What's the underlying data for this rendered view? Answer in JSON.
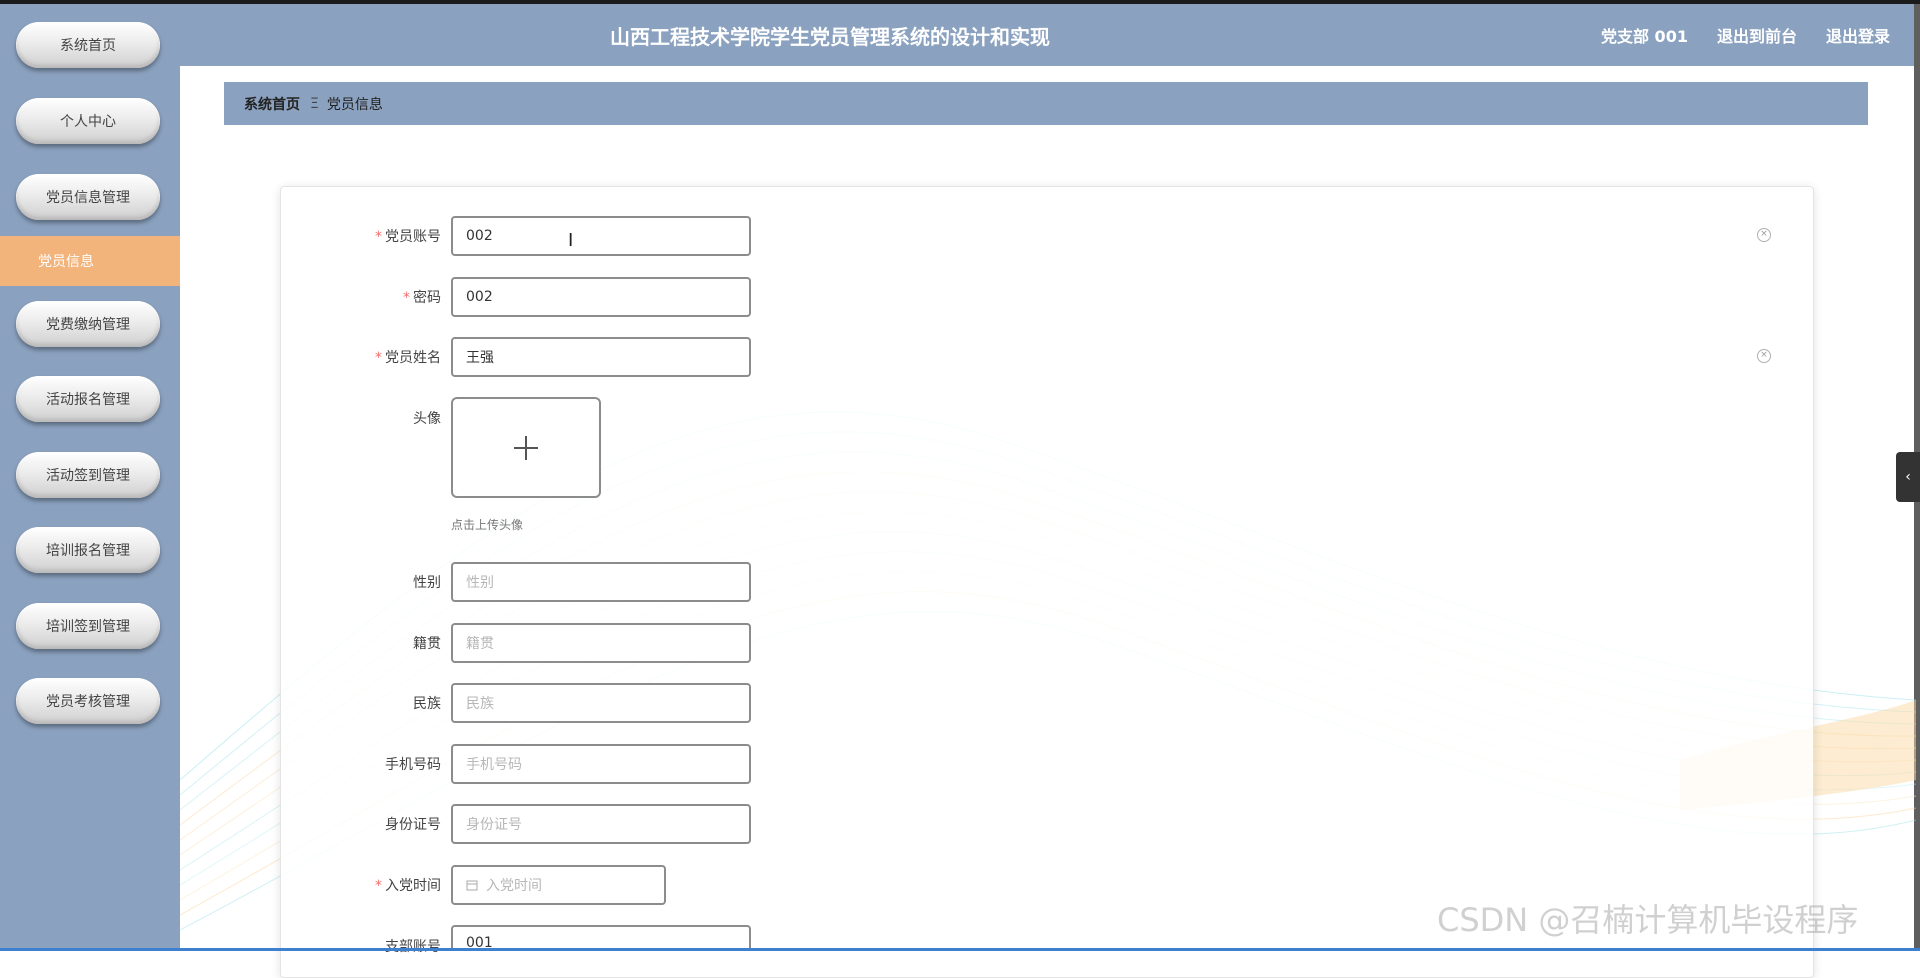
{
  "app": {
    "title": "山西工程技术学院学生党员管理系统的设计和实现"
  },
  "header": {
    "links": [
      "党支部 001",
      "退出到前台",
      "退出登录"
    ]
  },
  "sidebar": {
    "items": [
      {
        "label": "系统首页"
      },
      {
        "label": "个人中心"
      },
      {
        "label": "党员信息管理"
      },
      {
        "label": "党员信息",
        "active": true
      },
      {
        "label": "党费缴纳管理"
      },
      {
        "label": "活动报名管理"
      },
      {
        "label": "活动签到管理"
      },
      {
        "label": "培训报名管理"
      },
      {
        "label": "培训签到管理"
      },
      {
        "label": "党员考核管理"
      }
    ]
  },
  "breadcrumb": {
    "home": "系统首页",
    "separator": "Ξ",
    "current": "党员信息"
  },
  "form": {
    "account": {
      "label": "党员账号",
      "required": true,
      "value": "002"
    },
    "password": {
      "label": "密码",
      "required": true,
      "value": "002"
    },
    "name": {
      "label": "党员姓名",
      "required": true,
      "value": "王强"
    },
    "avatar": {
      "label": "头像",
      "hint": "点击上传头像"
    },
    "gender": {
      "label": "性别",
      "placeholder": "性别"
    },
    "origin": {
      "label": "籍贯",
      "placeholder": "籍贯"
    },
    "ethnicity": {
      "label": "民族",
      "placeholder": "民族"
    },
    "phone": {
      "label": "手机号码",
      "placeholder": "手机号码"
    },
    "id_number": {
      "label": "身份证号",
      "placeholder": "身份证号"
    },
    "join_date": {
      "label": "入党时间",
      "required": true,
      "placeholder": "入党时间"
    },
    "branch_account": {
      "label": "支部账号",
      "value": "001"
    }
  },
  "watermark": "CSDN @召楠计算机毕设程序",
  "colors": {
    "header_bg": "#8aa1bf",
    "active_item": "#f3b47c",
    "required_star": "#f56c6c"
  }
}
